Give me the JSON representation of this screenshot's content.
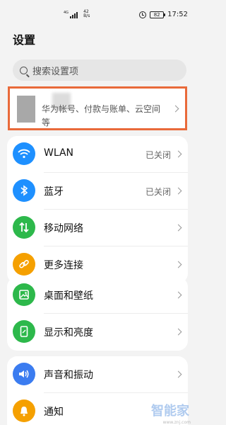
{
  "status_bar": {
    "network_type": "4G",
    "net_speed": "42",
    "net_speed_unit": "B/s",
    "battery": "82",
    "time": "17:52"
  },
  "page": {
    "title": "设置"
  },
  "search": {
    "placeholder": "搜索设置项"
  },
  "account": {
    "line1": "华为帐号、付款与账单、云空间",
    "line2": "等"
  },
  "network_items": [
    {
      "label": "WLAN",
      "value": "已关闭",
      "icon": "wifi-icon",
      "color": "#1e90ff"
    },
    {
      "label": "蓝牙",
      "value": "已关闭",
      "icon": "bluetooth-icon",
      "color": "#1e90ff"
    },
    {
      "label": "移动网络",
      "value": "",
      "icon": "mobile-data-icon",
      "color": "#2db84b"
    },
    {
      "label": "更多连接",
      "value": "",
      "icon": "link-icon",
      "color": "#f5a000"
    }
  ],
  "display_items": [
    {
      "label": "桌面和壁纸",
      "icon": "wallpaper-icon",
      "color": "#2db84b"
    },
    {
      "label": "显示和亮度",
      "icon": "display-icon",
      "color": "#2db84b"
    }
  ],
  "sound_items": [
    {
      "label": "声音和振动",
      "icon": "sound-icon",
      "color": "#3b7cf0"
    },
    {
      "label": "通知",
      "icon": "notification-icon",
      "color": "#f5a000"
    }
  ],
  "watermark": {
    "text": "智能家",
    "url": "www.znj.com"
  }
}
